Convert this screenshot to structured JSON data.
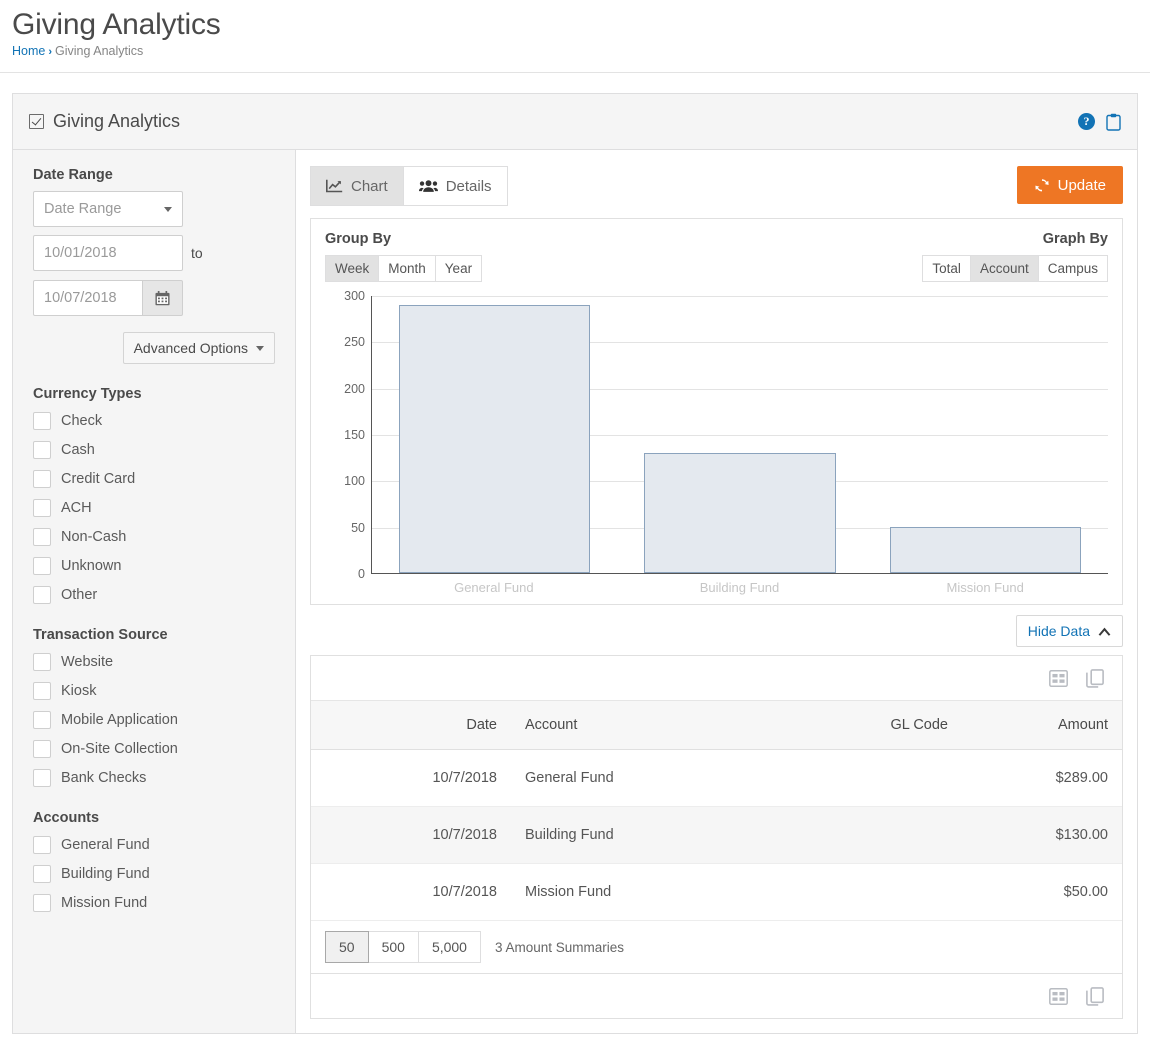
{
  "page": {
    "title": "Giving Analytics",
    "breadcrumb": {
      "home": "Home",
      "separator": "›",
      "current": "Giving Analytics"
    }
  },
  "panel": {
    "title": "Giving Analytics",
    "help_icon": "help-circle-icon",
    "clipboard_icon": "clipboard-icon"
  },
  "filters": {
    "date_range_label": "Date Range",
    "date_range_select": "Date Range",
    "start_date": "10/01/2018",
    "to_label": "to",
    "end_date": "10/07/2018",
    "calendar_icon": "calendar-icon",
    "advanced_options": "Advanced Options",
    "currency_types_label": "Currency Types",
    "currency_types": [
      "Check",
      "Cash",
      "Credit Card",
      "ACH",
      "Non-Cash",
      "Unknown",
      "Other"
    ],
    "transaction_source_label": "Transaction Source",
    "transaction_sources": [
      "Website",
      "Kiosk",
      "Mobile Application",
      "On-Site Collection",
      "Bank Checks"
    ],
    "accounts_label": "Accounts",
    "accounts": [
      "General Fund",
      "Building Fund",
      "Mission Fund"
    ]
  },
  "toolbar": {
    "tabs": [
      {
        "label": "Chart",
        "icon": "line-chart-icon",
        "active": true
      },
      {
        "label": "Details",
        "icon": "users-icon",
        "active": false
      }
    ],
    "update_label": "Update",
    "update_icon": "refresh-icon",
    "update_color": "#ee7624"
  },
  "chart_controls": {
    "group_by_label": "Group By",
    "group_by_options": [
      "Week",
      "Month",
      "Year"
    ],
    "group_by_selected": "Week",
    "graph_by_label": "Graph By",
    "graph_by_options": [
      "Total",
      "Account",
      "Campus"
    ],
    "graph_by_selected": "Account",
    "hide_data_label": "Hide Data",
    "hide_data_icon": "chevron-up-icon"
  },
  "chart_data": {
    "type": "bar",
    "title": "",
    "xlabel": "",
    "ylabel": "",
    "categories": [
      "General Fund",
      "Building Fund",
      "Mission Fund"
    ],
    "values": [
      289,
      130,
      50
    ],
    "ylim": [
      0,
      300
    ],
    "yticks": [
      0,
      50,
      100,
      150,
      200,
      250,
      300
    ],
    "grid": true,
    "legend": "none",
    "bar_fill": "#e4e9ef",
    "bar_stroke": "#8ba3bd"
  },
  "grid": {
    "table_icon": "table-icon",
    "copy_icon": "copy-icon",
    "columns": [
      {
        "key": "date",
        "label": "Date"
      },
      {
        "key": "account",
        "label": "Account"
      },
      {
        "key": "gl_code",
        "label": "GL Code"
      },
      {
        "key": "amount",
        "label": "Amount"
      }
    ],
    "rows": [
      {
        "date": "10/7/2018",
        "account": "General Fund",
        "gl_code": "",
        "amount": "$289.00"
      },
      {
        "date": "10/7/2018",
        "account": "Building Fund",
        "gl_code": "",
        "amount": "$130.00"
      },
      {
        "date": "10/7/2018",
        "account": "Mission Fund",
        "gl_code": "",
        "amount": "$50.00"
      }
    ],
    "page_sizes": [
      "50",
      "500",
      "5,000"
    ],
    "page_size_selected": "50",
    "summary_text": "3 Amount Summaries"
  }
}
